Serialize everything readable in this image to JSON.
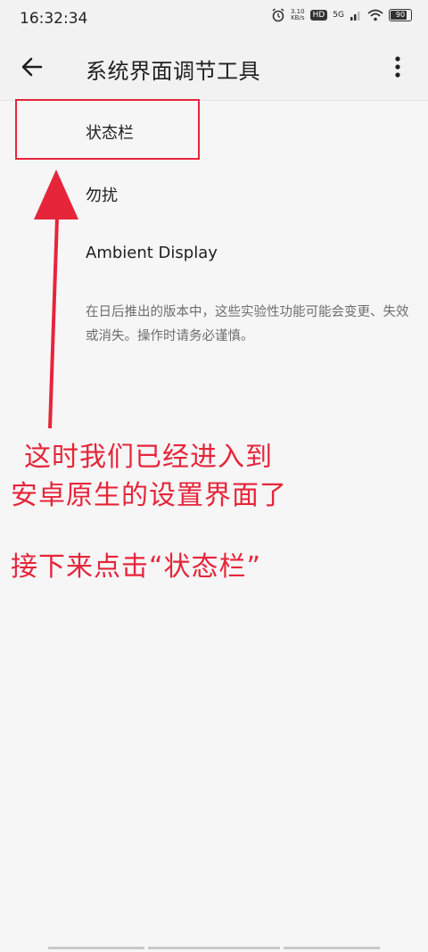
{
  "status_bar": {
    "time": "16:32:34",
    "net_speed_value": "3.10",
    "net_speed_unit": "KB/s",
    "hd_label": "HD",
    "signal_label": "5G",
    "battery_level": "90"
  },
  "toolbar": {
    "title": "系统界面调节工具"
  },
  "settings": {
    "items": [
      {
        "label": "状态栏"
      },
      {
        "label": "勿扰"
      },
      {
        "label": "Ambient Display"
      }
    ],
    "footer_note": "在日后推出的版本中，这些实验性功能可能会变更、失效或消失。操作时请务必谨慎。"
  },
  "annotation": {
    "color": "#e6253a",
    "line1": "这时我们已经进入到",
    "line2": "安卓原生的设置界面了",
    "line3": "接下来点击“状态栏”"
  }
}
